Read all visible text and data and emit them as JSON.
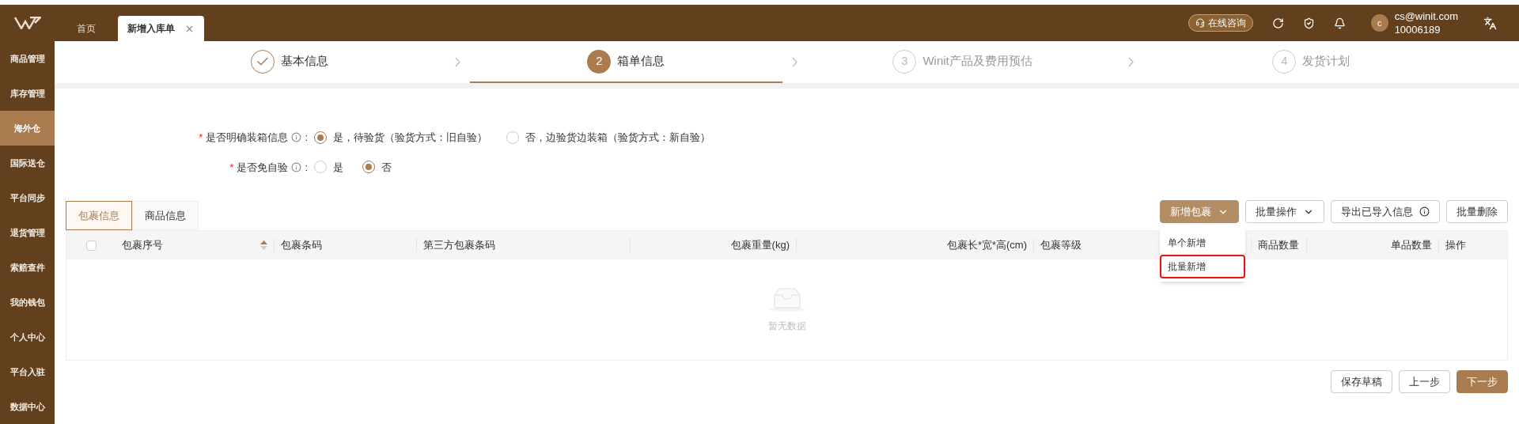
{
  "sidebar": {
    "items": [
      {
        "label": "商品管理",
        "selected": false
      },
      {
        "label": "库存管理",
        "selected": false
      },
      {
        "label": "海外仓",
        "selected": true
      },
      {
        "label": "国际送仓",
        "selected": false
      },
      {
        "label": "平台同步",
        "selected": false
      },
      {
        "label": "退货管理",
        "selected": false
      },
      {
        "label": "索赔查件",
        "selected": false
      },
      {
        "label": "我的钱包",
        "selected": false
      },
      {
        "label": "个人中心",
        "selected": false
      },
      {
        "label": "平台入驻",
        "selected": false
      },
      {
        "label": "数据中心",
        "selected": false
      }
    ]
  },
  "top_tabs": [
    {
      "label": "首页",
      "selected": false,
      "closable": false
    },
    {
      "label": "新增入库单",
      "selected": true,
      "closable": true
    }
  ],
  "header": {
    "consult": "在线咨询",
    "avatar": "c",
    "email": "cs@winit.com",
    "account": "10006189"
  },
  "steps": [
    {
      "label": "基本信息",
      "done": true,
      "selected": false
    },
    {
      "number": "2",
      "label": "箱单信息",
      "done": false,
      "selected": true
    },
    {
      "number": "3",
      "label": "Winit产品及费用预估",
      "done": false,
      "selected": false
    },
    {
      "number": "4",
      "label": "发货计划",
      "done": false,
      "selected": false
    }
  ],
  "form": [
    {
      "label": "是否明确装箱信息",
      "required_mark": "*",
      "colon": ":",
      "options": [
        {
          "label": "是，待验货（验货方式：旧自验）",
          "selected": true
        },
        {
          "label": "否，边验货边装箱（验货方式：新自验）",
          "selected": false
        }
      ]
    },
    {
      "label": "是否免自验",
      "required_mark": "*",
      "colon": ":",
      "options": [
        {
          "label": "是",
          "selected": false
        },
        {
          "label": "否",
          "selected": true
        }
      ]
    }
  ],
  "sub_tabs": [
    {
      "label": "包裹信息",
      "selected": true
    },
    {
      "label": "商品信息",
      "selected": false
    }
  ],
  "toolbar": [
    {
      "label": "新增包裹",
      "kind": "primary-dropdown"
    },
    {
      "label": "批量操作",
      "kind": "dropdown"
    },
    {
      "label": "导出已导入信息",
      "kind": "info"
    },
    {
      "label": "批量删除",
      "kind": "plain"
    }
  ],
  "dropdown": [
    {
      "label": "单个新增",
      "highlighted": false
    },
    {
      "label": "批量新增",
      "highlighted": true
    }
  ],
  "table": {
    "all_checked": false,
    "columns": [
      {
        "label": "包裹序号"
      },
      {
        "label": "包裹条码"
      },
      {
        "label": "第三方包裹条码"
      },
      {
        "label": "包裹重量(kg)"
      },
      {
        "label": "包裹长*宽*高(cm)"
      },
      {
        "label": "包裹等级"
      },
      {
        "label": "商品数量"
      },
      {
        "label": "单品数量"
      },
      {
        "label": "操作"
      }
    ],
    "empty": "暂无数据"
  },
  "footer": [
    {
      "label": "保存草稿",
      "kind": "plain"
    },
    {
      "label": "上一步",
      "kind": "plain"
    },
    {
      "label": "下一步",
      "kind": "primary"
    }
  ]
}
